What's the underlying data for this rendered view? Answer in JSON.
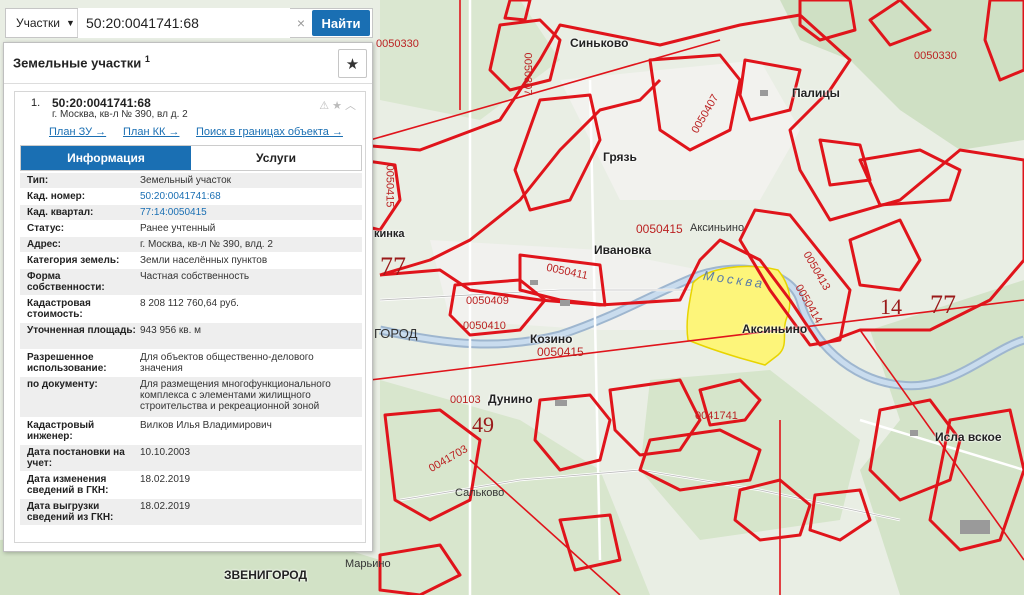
{
  "search": {
    "type_label": "Участки",
    "value": "50:20:0041741:68",
    "clear_icon": "close-icon",
    "button_label": "Найти"
  },
  "panel": {
    "title": "Земельные участки",
    "title_count": "1",
    "item_number": "1.",
    "cadastral_number": "50:20:0041741:68",
    "address_short": "г. Москва, кв-л № 390, вл д. 2",
    "links": [
      "План ЗУ →",
      "План КК →",
      "Поиск в границах объекта →"
    ],
    "tabs": [
      "Информация",
      "Услуги"
    ],
    "info": [
      {
        "key": "Тип:",
        "value": "Земельный участок"
      },
      {
        "key": "Кад. номер:",
        "value": "50:20:0041741:68",
        "link": true
      },
      {
        "key": "Кад. квартал:",
        "value": "77:14:0050415",
        "link": true
      },
      {
        "key": "Статус:",
        "value": "Ранее учтенный"
      },
      {
        "key": "Адрес:",
        "value": "г. Москва, кв-л № 390, влд. 2"
      },
      {
        "key": "Категория земель:",
        "value": "Земли населённых пунктов"
      },
      {
        "key": "Форма собственности:",
        "value": "Частная собственность"
      },
      {
        "key": "Кадастровая стоимость:",
        "value": "8 208 112 760,64 руб."
      },
      {
        "key": "Уточненная площадь:",
        "value": "943 956 кв. м"
      },
      {
        "key": "Разрешенное использование:",
        "value": "Для объектов общественно-делового значения"
      },
      {
        "key": "по документу:",
        "value": "Для размещения многофункционального комплекса с элементами жилищного строительства и рекреационной зоной"
      },
      {
        "key": "Кадастровый инженер:",
        "value": "Вилков Илья Владимирович"
      },
      {
        "key": "Дата постановки на учет:",
        "value": "10.10.2003"
      },
      {
        "key": "Дата изменения сведений в ГКН:",
        "value": "18.02.2019"
      },
      {
        "key": "Дата выгрузки сведений из ГКН:",
        "value": "18.02.2019"
      }
    ]
  },
  "map": {
    "places": [
      "Синьково",
      "Палицы",
      "Грязь",
      "Ивановка",
      "Аксиньино",
      "Аксиньино",
      "Козино",
      "Дунино",
      "Исла вское",
      "Сальково",
      "Марьино",
      "ЗВЕНИГОРОД",
      "ГОРОД",
      "кинка"
    ],
    "cadastral_labels": [
      "0050330",
      "0050330",
      "0050307",
      "0050407",
      "0050415",
      "0050415",
      "0050415",
      "0050411",
      "0050409",
      "0050410",
      "0050413",
      "0050414",
      "00103",
      "0041741",
      "0041703"
    ],
    "big_labels": [
      "77",
      "14",
      "77",
      "49"
    ],
    "river": "Москва",
    "highlight_color": "#fdf57a",
    "boundary_color": "#e0141b"
  }
}
